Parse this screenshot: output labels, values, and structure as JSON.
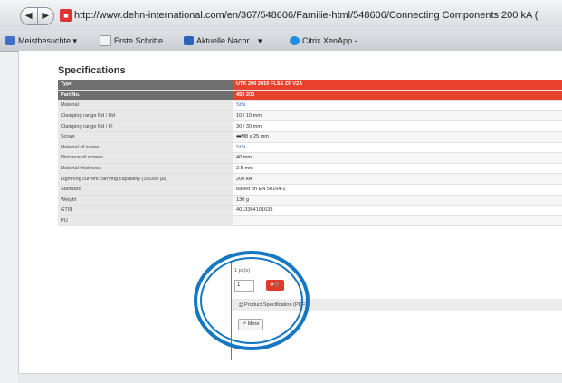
{
  "browser": {
    "nav_back": "◀",
    "nav_forward": "▶",
    "url": "http://www.dehn-international.com/en/367/548606/Familie-html/548606/Connecting Components 200 kA (",
    "bookmarks": [
      "Meistbesuchte ▾",
      "Erste Schritte",
      "Aktuelle Nachr... ▾",
      "Citrix XenApp -"
    ]
  },
  "page": {
    "section_title": "Specifications",
    "rows": [
      {
        "label": "Type",
        "value": "UTK 200 2010 FLSS ZP V2A"
      },
      {
        "label": "Part No.",
        "value": "459 200"
      },
      {
        "label": "Material",
        "value": "StSt"
      },
      {
        "label": "Clamping range Rd / Rd",
        "value": "10 / 10 mm"
      },
      {
        "label": "Clamping range Rd / Fl",
        "value": "30 / 30 mm"
      },
      {
        "label": "Screw",
        "value": "M8 x 25 mm"
      },
      {
        "label": "Material of screw",
        "value": "StSt"
      },
      {
        "label": "Distance of screws",
        "value": "40 mm"
      },
      {
        "label": "Material thickness",
        "value": "2.5 mm"
      },
      {
        "label": "Lightning current carrying capability (10/350 µs)",
        "value": "200 kA"
      },
      {
        "label": "Standard",
        "value": "based on EN 50164-1"
      },
      {
        "label": "Weight",
        "value": "130 g"
      },
      {
        "label": "GTIN",
        "value": "4013364101633"
      },
      {
        "label": "PU",
        "value": ""
      }
    ],
    "pu_value": "1 pc(s)",
    "quantity": "1",
    "cart_label": "➜🛒",
    "pdf_label": "⎙ Product Specification (PDF)",
    "more_label": "↗ More"
  }
}
